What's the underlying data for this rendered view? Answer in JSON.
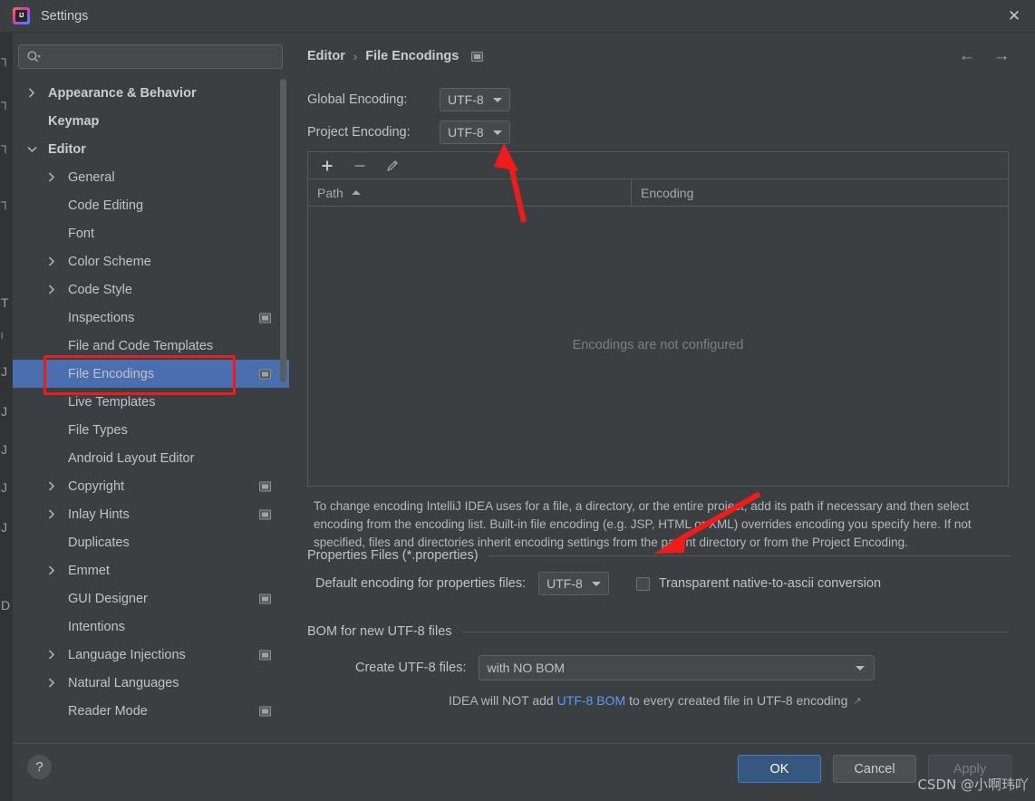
{
  "window": {
    "title": "Settings",
    "app_icon": "intellij-idea-icon",
    "close_label": "✕"
  },
  "search": {
    "placeholder": "",
    "value": "",
    "icon": "search-icon"
  },
  "sidebar": {
    "items": [
      {
        "label": "Appearance & Behavior",
        "indent": 0,
        "chevron": "right",
        "bold": true,
        "selected": false,
        "badge": false
      },
      {
        "label": "Keymap",
        "indent": 0,
        "chevron": "none",
        "bold": true,
        "selected": false,
        "badge": false
      },
      {
        "label": "Editor",
        "indent": 0,
        "chevron": "down",
        "bold": true,
        "selected": false,
        "badge": false
      },
      {
        "label": "General",
        "indent": 1,
        "chevron": "right",
        "bold": false,
        "selected": false,
        "badge": false
      },
      {
        "label": "Code Editing",
        "indent": 1,
        "chevron": "none",
        "bold": false,
        "selected": false,
        "badge": false
      },
      {
        "label": "Font",
        "indent": 1,
        "chevron": "none",
        "bold": false,
        "selected": false,
        "badge": false
      },
      {
        "label": "Color Scheme",
        "indent": 1,
        "chevron": "right",
        "bold": false,
        "selected": false,
        "badge": false
      },
      {
        "label": "Code Style",
        "indent": 1,
        "chevron": "right",
        "bold": false,
        "selected": false,
        "badge": false
      },
      {
        "label": "Inspections",
        "indent": 1,
        "chevron": "none",
        "bold": false,
        "selected": false,
        "badge": true
      },
      {
        "label": "File and Code Templates",
        "indent": 1,
        "chevron": "none",
        "bold": false,
        "selected": false,
        "badge": false
      },
      {
        "label": "File Encodings",
        "indent": 1,
        "chevron": "none",
        "bold": false,
        "selected": true,
        "badge": true
      },
      {
        "label": "Live Templates",
        "indent": 1,
        "chevron": "none",
        "bold": false,
        "selected": false,
        "badge": false
      },
      {
        "label": "File Types",
        "indent": 1,
        "chevron": "none",
        "bold": false,
        "selected": false,
        "badge": false
      },
      {
        "label": "Android Layout Editor",
        "indent": 1,
        "chevron": "none",
        "bold": false,
        "selected": false,
        "badge": false
      },
      {
        "label": "Copyright",
        "indent": 1,
        "chevron": "right",
        "bold": false,
        "selected": false,
        "badge": true
      },
      {
        "label": "Inlay Hints",
        "indent": 1,
        "chevron": "right",
        "bold": false,
        "selected": false,
        "badge": true
      },
      {
        "label": "Duplicates",
        "indent": 1,
        "chevron": "none",
        "bold": false,
        "selected": false,
        "badge": false
      },
      {
        "label": "Emmet",
        "indent": 1,
        "chevron": "right",
        "bold": false,
        "selected": false,
        "badge": false
      },
      {
        "label": "GUI Designer",
        "indent": 1,
        "chevron": "none",
        "bold": false,
        "selected": false,
        "badge": true
      },
      {
        "label": "Intentions",
        "indent": 1,
        "chevron": "none",
        "bold": false,
        "selected": false,
        "badge": false
      },
      {
        "label": "Language Injections",
        "indent": 1,
        "chevron": "right",
        "bold": false,
        "selected": false,
        "badge": true
      },
      {
        "label": "Natural Languages",
        "indent": 1,
        "chevron": "right",
        "bold": false,
        "selected": false,
        "badge": false
      },
      {
        "label": "Reader Mode",
        "indent": 1,
        "chevron": "none",
        "bold": false,
        "selected": false,
        "badge": true
      }
    ]
  },
  "breadcrumb": {
    "parent": "Editor",
    "separator": "›",
    "current": "File Encodings"
  },
  "nav": {
    "back": "←",
    "forward": "→"
  },
  "encodings": {
    "global_label": "Global Encoding:",
    "global_value": "UTF-8",
    "project_label": "Project Encoding:",
    "project_value": "UTF-8"
  },
  "table": {
    "toolbar": {
      "add": "add-icon",
      "remove": "remove-icon",
      "edit": "edit-pencil-icon"
    },
    "columns": [
      "Path",
      "Encoding"
    ],
    "sort_column": "Path",
    "sort_direction": "asc",
    "rows": [],
    "empty_text": "Encodings are not configured"
  },
  "description": "To change encoding IntelliJ IDEA uses for a file, a directory, or the entire project, add its path if necessary and then select encoding from the encoding list. Built-in file encoding (e.g. JSP, HTML or XML) overrides encoding you specify here. If not specified, files and directories inherit encoding settings from the parent directory or from the Project Encoding.",
  "properties_group": {
    "title": "Properties Files (*.properties)",
    "default_encoding_label": "Default encoding for properties files:",
    "default_encoding_value": "UTF-8",
    "transparent_label": "Transparent native-to-ascii conversion",
    "transparent_checked": false
  },
  "bom_group": {
    "title": "BOM for new UTF-8 files",
    "create_label": "Create UTF-8 files:",
    "create_value": "with NO BOM",
    "hint_prefix": "IDEA will NOT add",
    "hint_link": "UTF-8 BOM",
    "hint_suffix": "to every created file in UTF-8 encoding",
    "external_icon": "↗"
  },
  "footer": {
    "help": "?",
    "ok": "OK",
    "cancel": "Cancel",
    "apply": "Apply"
  },
  "watermark": "CSDN @小啊玮吖",
  "colors": {
    "selection_blue": "#4b6eaf",
    "ok_button": "#365880",
    "link_blue": "#589df6",
    "annotation_red": "#f01c1c",
    "panel_bg": "#3c3f41"
  },
  "annotations": {
    "highlight_box": "file-encodings-sidebar-item",
    "arrow_1_target": "project-encoding-combo",
    "arrow_2_target": "properties-files-group"
  },
  "bg_window_glyphs": [
    "┐",
    "┐",
    "┐",
    "┐",
    "T",
    "ᴵ",
    "J",
    "J",
    "J",
    "J",
    "J",
    "D"
  ]
}
